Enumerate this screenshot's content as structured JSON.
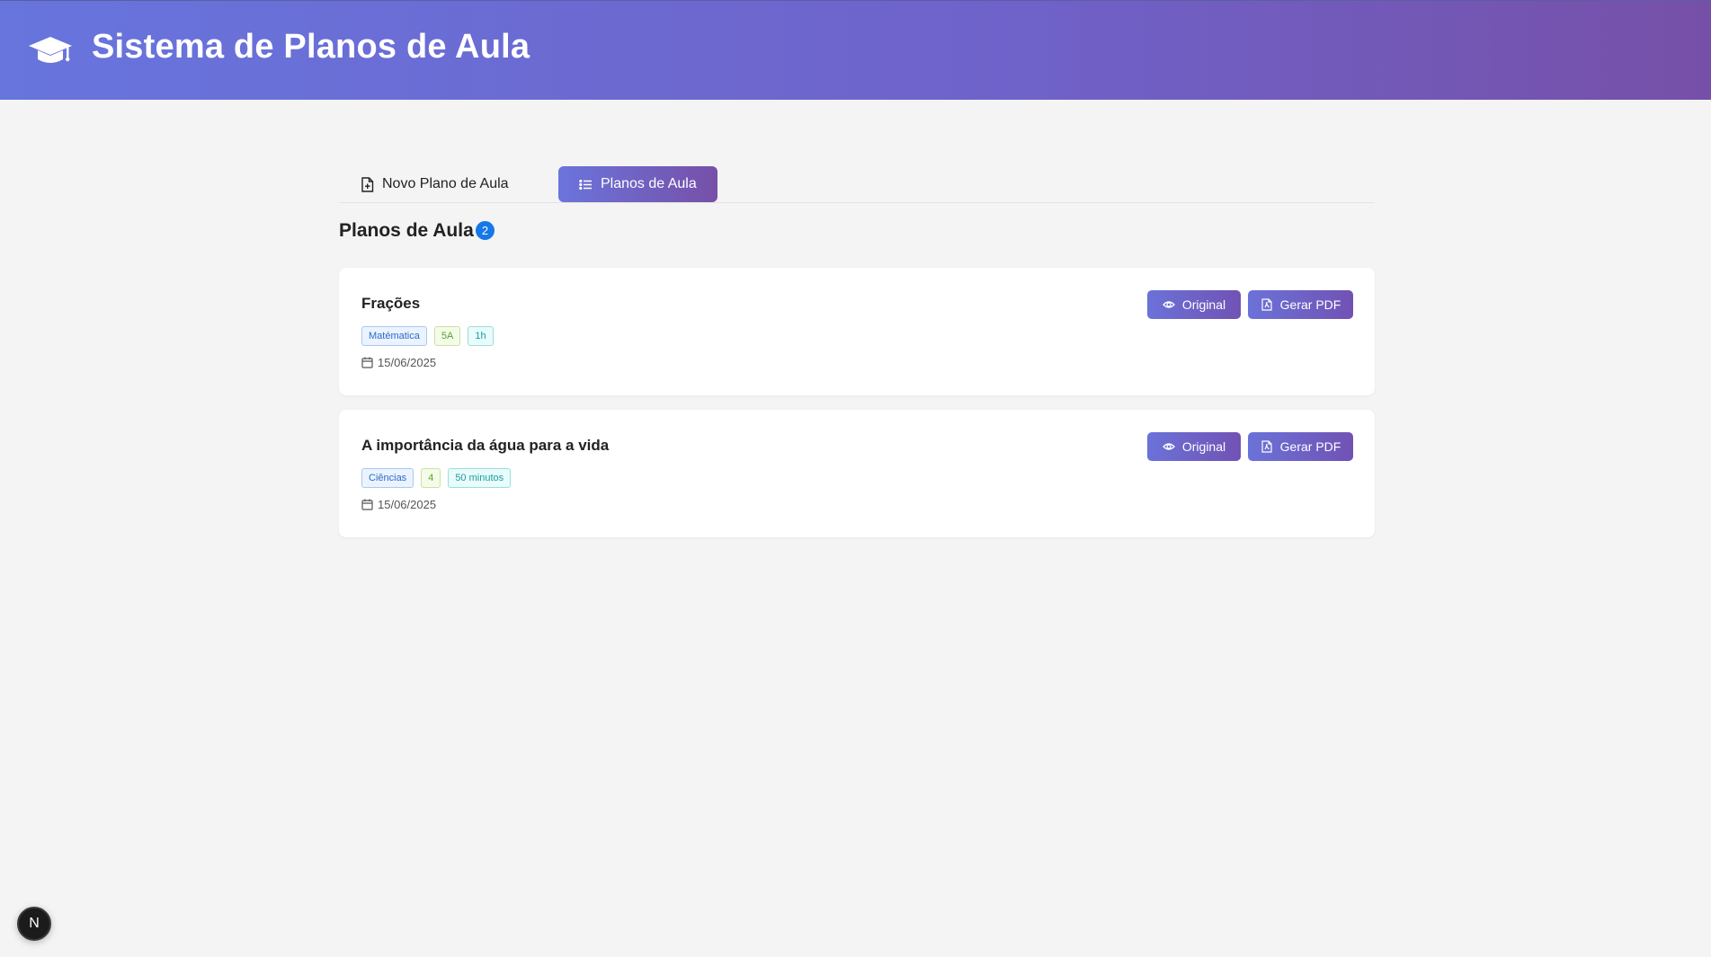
{
  "header": {
    "title": "Sistema de Planos de Aula",
    "logo_icon": "graduation-cap-icon"
  },
  "tabs": [
    {
      "label": "Novo Plano de Aula",
      "icon": "file-plus-icon",
      "active": false
    },
    {
      "label": "Planos de Aula",
      "icon": "list-icon",
      "active": true
    }
  ],
  "section": {
    "title": "Planos de Aula",
    "count": "2"
  },
  "plans": [
    {
      "title": "Frações",
      "tags": [
        "Matématica",
        "5A",
        "1h"
      ],
      "date": "15/06/2025",
      "original_label": "Original",
      "pdf_label": "Gerar PDF"
    },
    {
      "title": "A importância da água para a vida",
      "tags": [
        "Ciências",
        "4",
        "50 minutos"
      ],
      "date": "15/06/2025",
      "original_label": "Original",
      "pdf_label": "Gerar PDF"
    }
  ],
  "dev_badge": {
    "label": "N"
  },
  "colors": {
    "accent_start": "#6775dd",
    "accent_end": "#7650a8",
    "count_badge": "#1677e8"
  }
}
